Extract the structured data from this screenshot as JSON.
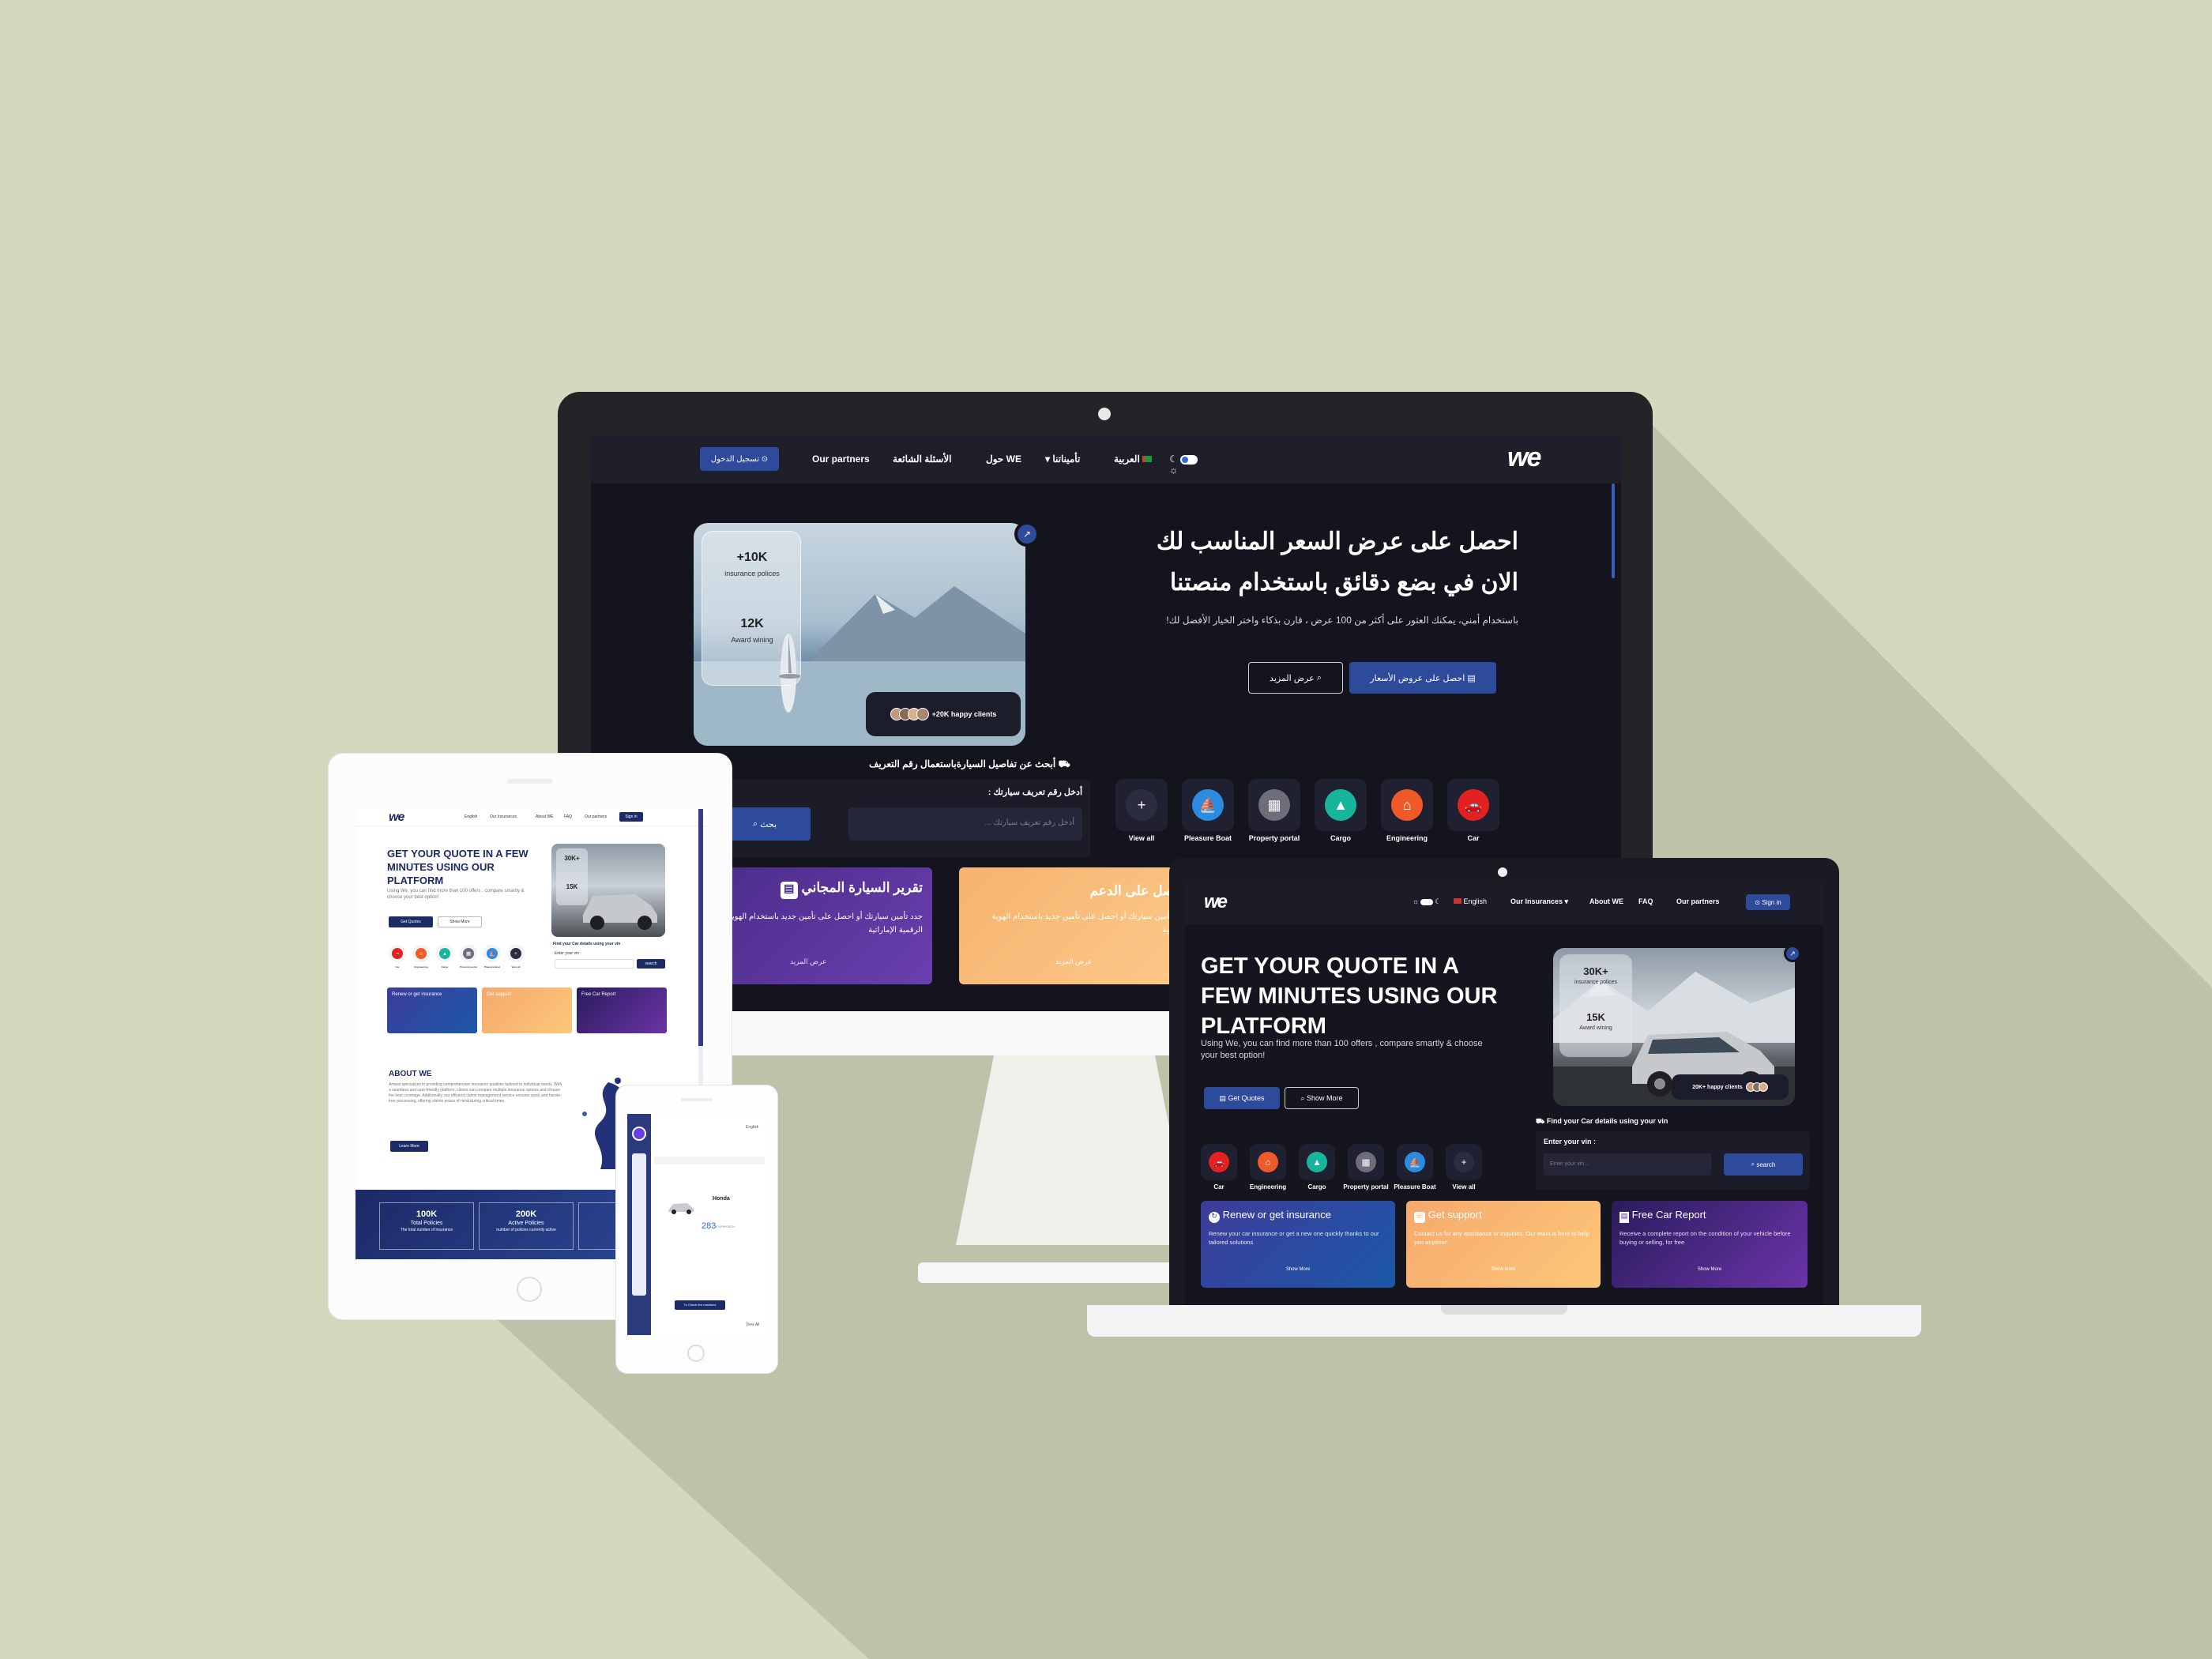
{
  "monitor": {
    "nav": {
      "logo": "we",
      "signin": "تسجيل الدخول ⊙",
      "links": [
        "Our partners",
        "الأسئلة الشائعة",
        "حول WE",
        "تأميناتنا"
      ],
      "language": "العربية"
    },
    "hero": {
      "title_line1": "احصل على عرض السعر المناسب لك",
      "title_line2": "الان في بضع دقائق باستخدام منصتنا",
      "subtitle": "باستخدام أمني، يمكنك العثور على أكثر من 100 عرض ، قارن بذكاء واختر الخيار الأفضل لك!",
      "btn_quotes": "احصل على عروض الأسعار",
      "btn_more": "عرض المزيد",
      "stat1_value": "+10K",
      "stat1_label": "insurance polices",
      "stat2_value": "12K",
      "stat2_label": "Award wining",
      "happy": "+20K happy clients"
    },
    "vin": {
      "heading": "أبحث عن تفاصيل السيارةباستعمال رقم التعريف",
      "label": "أدخل رقم تعريف سيارتك :",
      "placeholder": "أدخل رقم تعريف سيارتك ...",
      "search": "بحث"
    },
    "categories": [
      {
        "label": "View all",
        "color": "#2b2c40",
        "icon": "+"
      },
      {
        "label": "Pleasure Boat",
        "color": "#2a8be0",
        "icon": "⛵"
      },
      {
        "label": "Property portal",
        "color": "#6d6e7a",
        "icon": "▦"
      },
      {
        "label": "Cargo",
        "color": "#17b69c",
        "icon": "▲"
      },
      {
        "label": "Engineering",
        "color": "#f05a28",
        "icon": "⌂"
      },
      {
        "label": "Car",
        "color": "#e42121",
        "icon": "🚗"
      }
    ],
    "cards": [
      {
        "title": "تقرير السيارة المجاني",
        "body": "جدد تأمين سيارتك أو احصل على تأمين جديد باستخدام الهوية الرقمية الإماراتية",
        "link": "عرض المزيد"
      },
      {
        "title": "احصل على الدعم",
        "body": "جدد تأمين سيارتك أو احصل على تأمين جديد باستخدام الهوية الرقمية",
        "link": "عرض المزيد"
      }
    ]
  },
  "laptop": {
    "nav": {
      "logo": "we",
      "language": "English",
      "links": [
        "Our Insurances",
        "About WE",
        "FAQ",
        "Our partners"
      ],
      "signin": "Sign in"
    },
    "hero": {
      "title": "GET YOUR QUOTE IN A FEW MINUTES USING OUR PLATFORM",
      "subtitle": "Using We, you can find more than 100 offers , compare smartly & choose your best option!",
      "btn_quotes": "Get Quotes",
      "btn_more": "Show More",
      "stat1_value": "30K+",
      "stat1_label": "insurance polices",
      "stat2_value": "15K",
      "stat2_label": "Award wining",
      "happy": "20K+ happy clients"
    },
    "vin": {
      "heading": "Find your Car details using your vin",
      "label": "Enter your vin :",
      "placeholder": "Enter your vin...",
      "search": "search"
    },
    "categories": [
      {
        "label": "Car",
        "color": "#e42121",
        "icon": "🚗"
      },
      {
        "label": "Engineering",
        "color": "#f05a28",
        "icon": "⌂"
      },
      {
        "label": "Cargo",
        "color": "#17b69c",
        "icon": "▲"
      },
      {
        "label": "Property portal",
        "color": "#6d6e7a",
        "icon": "▦"
      },
      {
        "label": "Pleasure Boat",
        "color": "#2a8be0",
        "icon": "⛵"
      },
      {
        "label": "View all",
        "color": "#2b2c40",
        "icon": "+"
      }
    ],
    "cards": [
      {
        "title": "Renew or get insurance",
        "body": "Renew your car insurance or get a new one quickly thanks to our tailored solutions",
        "link": "Show More"
      },
      {
        "title": "Get support",
        "body": "Contact us for any assistance or inquiries. Our team is here to help you anytime!",
        "link": "Show More"
      },
      {
        "title": "Free Car Report",
        "body": "Receive a complete report on the condition of your vehicle before buying or selling, for free",
        "link": "Show More"
      }
    ]
  },
  "tablet": {
    "nav": {
      "logo": "we",
      "language": "English",
      "links": [
        "Our Insurances",
        "About WE",
        "FAQ",
        "Our partners"
      ],
      "signin": "Sign in"
    },
    "hero": {
      "title": "GET YOUR QUOTE IN A FEW MINUTES USING OUR PLATFORM",
      "subtitle": "Using We, you can find more than 100 offers , compare smartly & choose your best option!",
      "btn_quotes": "Get Quotes",
      "btn_more": "Show More",
      "stat1": "30K+",
      "stat2": "15K"
    },
    "vin_heading": "Find your Car details using your vin",
    "vin_label": "Enter your vin :",
    "vin_search": "search",
    "cards": [
      "Renew or get insurance",
      "Get support",
      "Free Car Report"
    ],
    "about": {
      "title": "ABOUT WE",
      "body": "Amwal specializes in providing comprehensive insurance qualities tailored to individual needs. With a seamless and user-friendly platform, clients can compare multiple insurance options and choose the best coverage. Additionally, our efficient claims management service ensures quick and hassle-free processing, offering clients peace of mind during critical times.",
      "button": "Learn More"
    },
    "stats": [
      {
        "value": "100K",
        "label": "Total Policies",
        "sub": "The total number of insurance"
      },
      {
        "value": "200K",
        "label": "Active Policies",
        "sub": "number of policies currently active"
      },
      {
        "value": "Cu",
        "label": "",
        "sub": "Num of"
      }
    ]
  },
  "phone": {
    "language": "English",
    "car": {
      "name": "Honda",
      "value": "283",
      "unit": "EGP/MONTH"
    },
    "button": "To Check the reactions",
    "view_all": "View All"
  }
}
